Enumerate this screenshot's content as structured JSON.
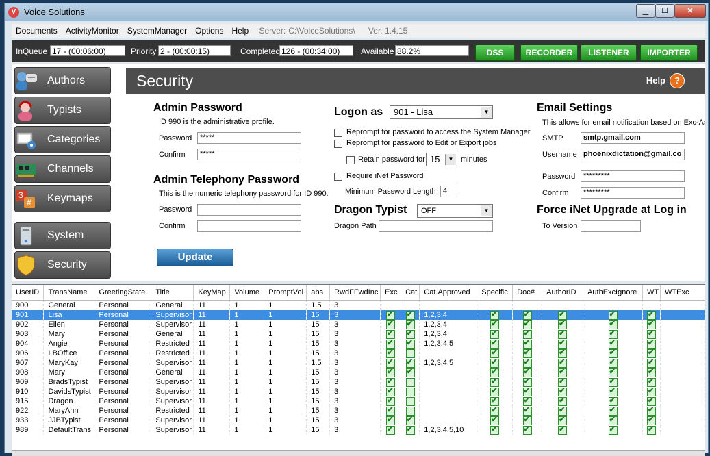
{
  "window": {
    "title": "Voice Solutions",
    "minimize": "▁",
    "maximize": "☐",
    "close": "✕"
  },
  "menu": {
    "items": [
      "Documents",
      "ActivityMonitor",
      "SystemManager",
      "Options",
      "Help"
    ],
    "server_label": "Server:",
    "server_value": "C:\\VoiceSolutions\\",
    "version": "Ver. 1.4.15"
  },
  "status": {
    "inqueue_label": "InQueue",
    "inqueue_value": "17 - (00:06:00)",
    "priority_label": "Priority",
    "priority_value": "2 - (00:00:15)",
    "completed_label": "Completed",
    "completed_value": "126 - (00:34:00)",
    "available_label": "Available",
    "available_value": "88.2%",
    "buttons": [
      "DSS",
      "RECORDER",
      "LISTENER",
      "IMPORTER"
    ]
  },
  "sidebar": {
    "items": [
      {
        "label": "Authors",
        "icon": "authors-icon"
      },
      {
        "label": "Typists",
        "icon": "typist-headset-icon"
      },
      {
        "label": "Categories",
        "icon": "categories-icon"
      },
      {
        "label": "Channels",
        "icon": "channels-card-icon"
      },
      {
        "label": "Keymaps",
        "icon": "keymaps-icon"
      },
      {
        "label": "System",
        "icon": "system-tower-icon"
      },
      {
        "label": "Security",
        "icon": "security-shield-icon"
      }
    ]
  },
  "security": {
    "title": "Security",
    "help": "Help",
    "admin_password": {
      "heading": "Admin Password",
      "desc": "ID 990 is the administrative profile.",
      "password_label": "Password",
      "password_value": "*****",
      "confirm_label": "Confirm",
      "confirm_value": "*****"
    },
    "admin_telephony": {
      "heading": "Admin Telephony Password",
      "desc": "This is the numeric telephony password for ID 990.",
      "password_label": "Password",
      "password_value": "",
      "confirm_label": "Confirm",
      "confirm_value": ""
    },
    "logon": {
      "heading": "Logon as",
      "selected": "901 - Lisa",
      "reprompt_sm": "Reprompt for password to access the System Manager",
      "reprompt_edit": "Reprompt for password to Edit or Export jobs",
      "retain_label": "Retain password for",
      "retain_value": "15",
      "retain_unit": "minutes",
      "require_inet": "Require iNet Password",
      "min_len_label": "Minimum Password Length",
      "min_len_value": "4"
    },
    "dragon": {
      "heading": "Dragon Typist",
      "selected": "OFF",
      "path_label": "Dragon Path",
      "path_value": ""
    },
    "email": {
      "heading": "Email Settings",
      "desc": "This allows for email notification based on Exc-Asg",
      "smtp_label": "SMTP",
      "smtp_value": "smtp.gmail.com",
      "username_label": "Username",
      "username_value": "phoenixdictation@gmail.co",
      "password_label": "Password",
      "password_value": "*********",
      "confirm_label": "Confirm",
      "confirm_value": "*********"
    },
    "force_inet": {
      "heading": "Force iNet Upgrade at Log in",
      "version_label": "To Version",
      "version_value": ""
    },
    "update_button": "Update"
  },
  "grid": {
    "columns": [
      "UserID",
      "TransName",
      "GreetingState",
      "Title",
      "KeyMap",
      "Volume",
      "PromptVol",
      "abs",
      "RwdFFwdInc",
      "Exc",
      "Cat.",
      "Cat.Approved",
      "Specific",
      "Doc#",
      "AuthorID",
      "AuthExcIgnore",
      "WT",
      "WTExc"
    ],
    "selected_row": 1,
    "rows": [
      {
        "id": "900",
        "name": "General",
        "greet": "Personal",
        "title": "General",
        "keymap": "11",
        "vol": "1",
        "pvol": "1",
        "abs": "1.5",
        "rwd": "3",
        "exc": false,
        "cat": false,
        "approved": "",
        "specific": false,
        "doc": false,
        "author": false,
        "authexc": false,
        "wt": false
      },
      {
        "id": "901",
        "name": "Lisa",
        "greet": "Personal",
        "title": "Supervisor",
        "keymap": "11",
        "vol": "1",
        "pvol": "1",
        "abs": "15",
        "rwd": "3",
        "exc": true,
        "cat": true,
        "approved": "1,2,3,4",
        "specific": true,
        "doc": true,
        "author": true,
        "authexc": true,
        "wt": true
      },
      {
        "id": "902",
        "name": "Ellen",
        "greet": "Personal",
        "title": "Supervisor",
        "keymap": "11",
        "vol": "1",
        "pvol": "1",
        "abs": "15",
        "rwd": "3",
        "exc": true,
        "cat": true,
        "approved": "1,2,3,4",
        "specific": true,
        "doc": true,
        "author": true,
        "authexc": true,
        "wt": true
      },
      {
        "id": "903",
        "name": "Mary",
        "greet": "Personal",
        "title": "General",
        "keymap": "11",
        "vol": "1",
        "pvol": "1",
        "abs": "15",
        "rwd": "3",
        "exc": true,
        "cat": true,
        "approved": "1,2,3,4",
        "specific": true,
        "doc": true,
        "author": true,
        "authexc": true,
        "wt": true
      },
      {
        "id": "904",
        "name": "Angie",
        "greet": "Personal",
        "title": "Restricted",
        "keymap": "11",
        "vol": "1",
        "pvol": "1",
        "abs": "15",
        "rwd": "3",
        "exc": true,
        "cat": true,
        "approved": "1,2,3,4,5",
        "specific": true,
        "doc": true,
        "author": true,
        "authexc": true,
        "wt": true
      },
      {
        "id": "906",
        "name": "LBOffice",
        "greet": "Personal",
        "title": "Restricted",
        "keymap": "11",
        "vol": "1",
        "pvol": "1",
        "abs": "15",
        "rwd": "3",
        "exc": true,
        "cat": false,
        "approved": "",
        "specific": true,
        "doc": true,
        "author": true,
        "authexc": true,
        "wt": true
      },
      {
        "id": "907",
        "name": "MaryKay",
        "greet": "Personal",
        "title": "Supervisor",
        "keymap": "11",
        "vol": "1",
        "pvol": "1",
        "abs": "1.5",
        "rwd": "3",
        "exc": true,
        "cat": true,
        "approved": "1,2,3,4,5",
        "specific": true,
        "doc": true,
        "author": true,
        "authexc": true,
        "wt": true
      },
      {
        "id": "908",
        "name": "Mary",
        "greet": "Personal",
        "title": "General",
        "keymap": "11",
        "vol": "1",
        "pvol": "1",
        "abs": "15",
        "rwd": "3",
        "exc": true,
        "cat": true,
        "approved": "",
        "specific": true,
        "doc": true,
        "author": true,
        "authexc": true,
        "wt": true
      },
      {
        "id": "909",
        "name": "BradsTypist",
        "greet": "Personal",
        "title": "Supervisor",
        "keymap": "11",
        "vol": "1",
        "pvol": "1",
        "abs": "15",
        "rwd": "3",
        "exc": true,
        "cat": false,
        "approved": "",
        "specific": true,
        "doc": true,
        "author": true,
        "authexc": true,
        "wt": true
      },
      {
        "id": "910",
        "name": "DavidsTypist",
        "greet": "Personal",
        "title": "Supervisor",
        "keymap": "11",
        "vol": "1",
        "pvol": "1",
        "abs": "15",
        "rwd": "3",
        "exc": true,
        "cat": false,
        "approved": "",
        "specific": true,
        "doc": true,
        "author": true,
        "authexc": true,
        "wt": true
      },
      {
        "id": "915",
        "name": "Dragon",
        "greet": "Personal",
        "title": "Supervisor",
        "keymap": "11",
        "vol": "1",
        "pvol": "1",
        "abs": "15",
        "rwd": "3",
        "exc": true,
        "cat": false,
        "approved": "",
        "specific": true,
        "doc": true,
        "author": true,
        "authexc": true,
        "wt": true
      },
      {
        "id": "922",
        "name": "MaryAnn",
        "greet": "Personal",
        "title": "Restricted",
        "keymap": "11",
        "vol": "1",
        "pvol": "1",
        "abs": "15",
        "rwd": "3",
        "exc": true,
        "cat": false,
        "approved": "",
        "specific": true,
        "doc": true,
        "author": true,
        "authexc": true,
        "wt": true
      },
      {
        "id": "933",
        "name": "JJBTypist",
        "greet": "Personal",
        "title": "Supervisor",
        "keymap": "11",
        "vol": "1",
        "pvol": "1",
        "abs": "15",
        "rwd": "3",
        "exc": true,
        "cat": true,
        "approved": "",
        "specific": true,
        "doc": true,
        "author": true,
        "authexc": true,
        "wt": true
      },
      {
        "id": "989",
        "name": "DefaultTrans",
        "greet": "Personal",
        "title": "Supervisor",
        "keymap": "11",
        "vol": "1",
        "pvol": "1",
        "abs": "15",
        "rwd": "3",
        "exc": true,
        "cat": true,
        "approved": "1,2,3,4,5,10",
        "specific": true,
        "doc": true,
        "author": true,
        "authexc": true,
        "wt": true
      }
    ]
  }
}
